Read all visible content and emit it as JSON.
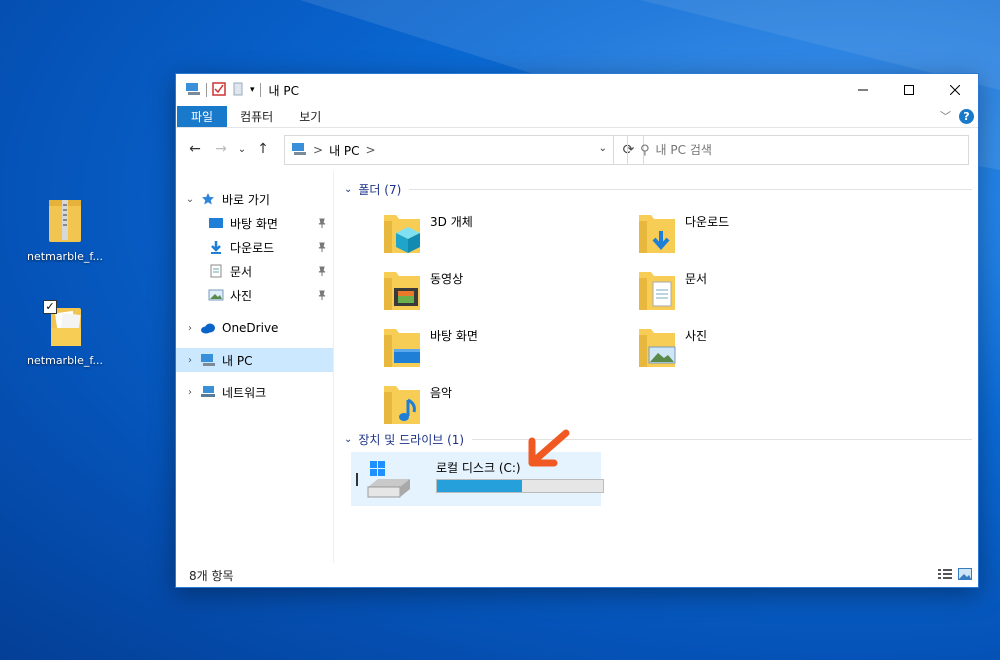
{
  "desktop": {
    "icons": [
      {
        "label": "netmarble_f...",
        "icon": "zip-folder-icon"
      },
      {
        "label": "netmarble_f...",
        "icon": "folder-icon",
        "selected_checkbox": true
      }
    ]
  },
  "window": {
    "title": "내 PC",
    "ribbon_tabs": [
      "파일",
      "컴퓨터",
      "보기"
    ],
    "help_glyph": "?",
    "address": {
      "crumb": "내 PC",
      "separator": ">"
    },
    "search": {
      "placeholder": "내 PC 검색"
    },
    "nav_pane": {
      "quick_access": "바로 가기",
      "pinned": [
        "바탕 화면",
        "다운로드",
        "문서",
        "사진"
      ],
      "onedrive": "OneDrive",
      "this_pc": "내 PC",
      "network": "네트워크"
    },
    "folders_header": "폴더 (7)",
    "folders": [
      "3D 개체",
      "다운로드",
      "동영상",
      "문서",
      "바탕 화면",
      "사진",
      "음악"
    ],
    "drives_header": "장치 및 드라이브 (1)",
    "drive": {
      "name": "로컬 디스크 (C:)",
      "used_fraction": 0.51
    },
    "status": {
      "item_count": "8개 항목"
    }
  },
  "colors": {
    "accent": "#1979ca",
    "selection": "#cce8ff",
    "drive_bar": "#26a0da",
    "arrow": "#f05a22",
    "folder_yellow": "#f7cd55"
  }
}
